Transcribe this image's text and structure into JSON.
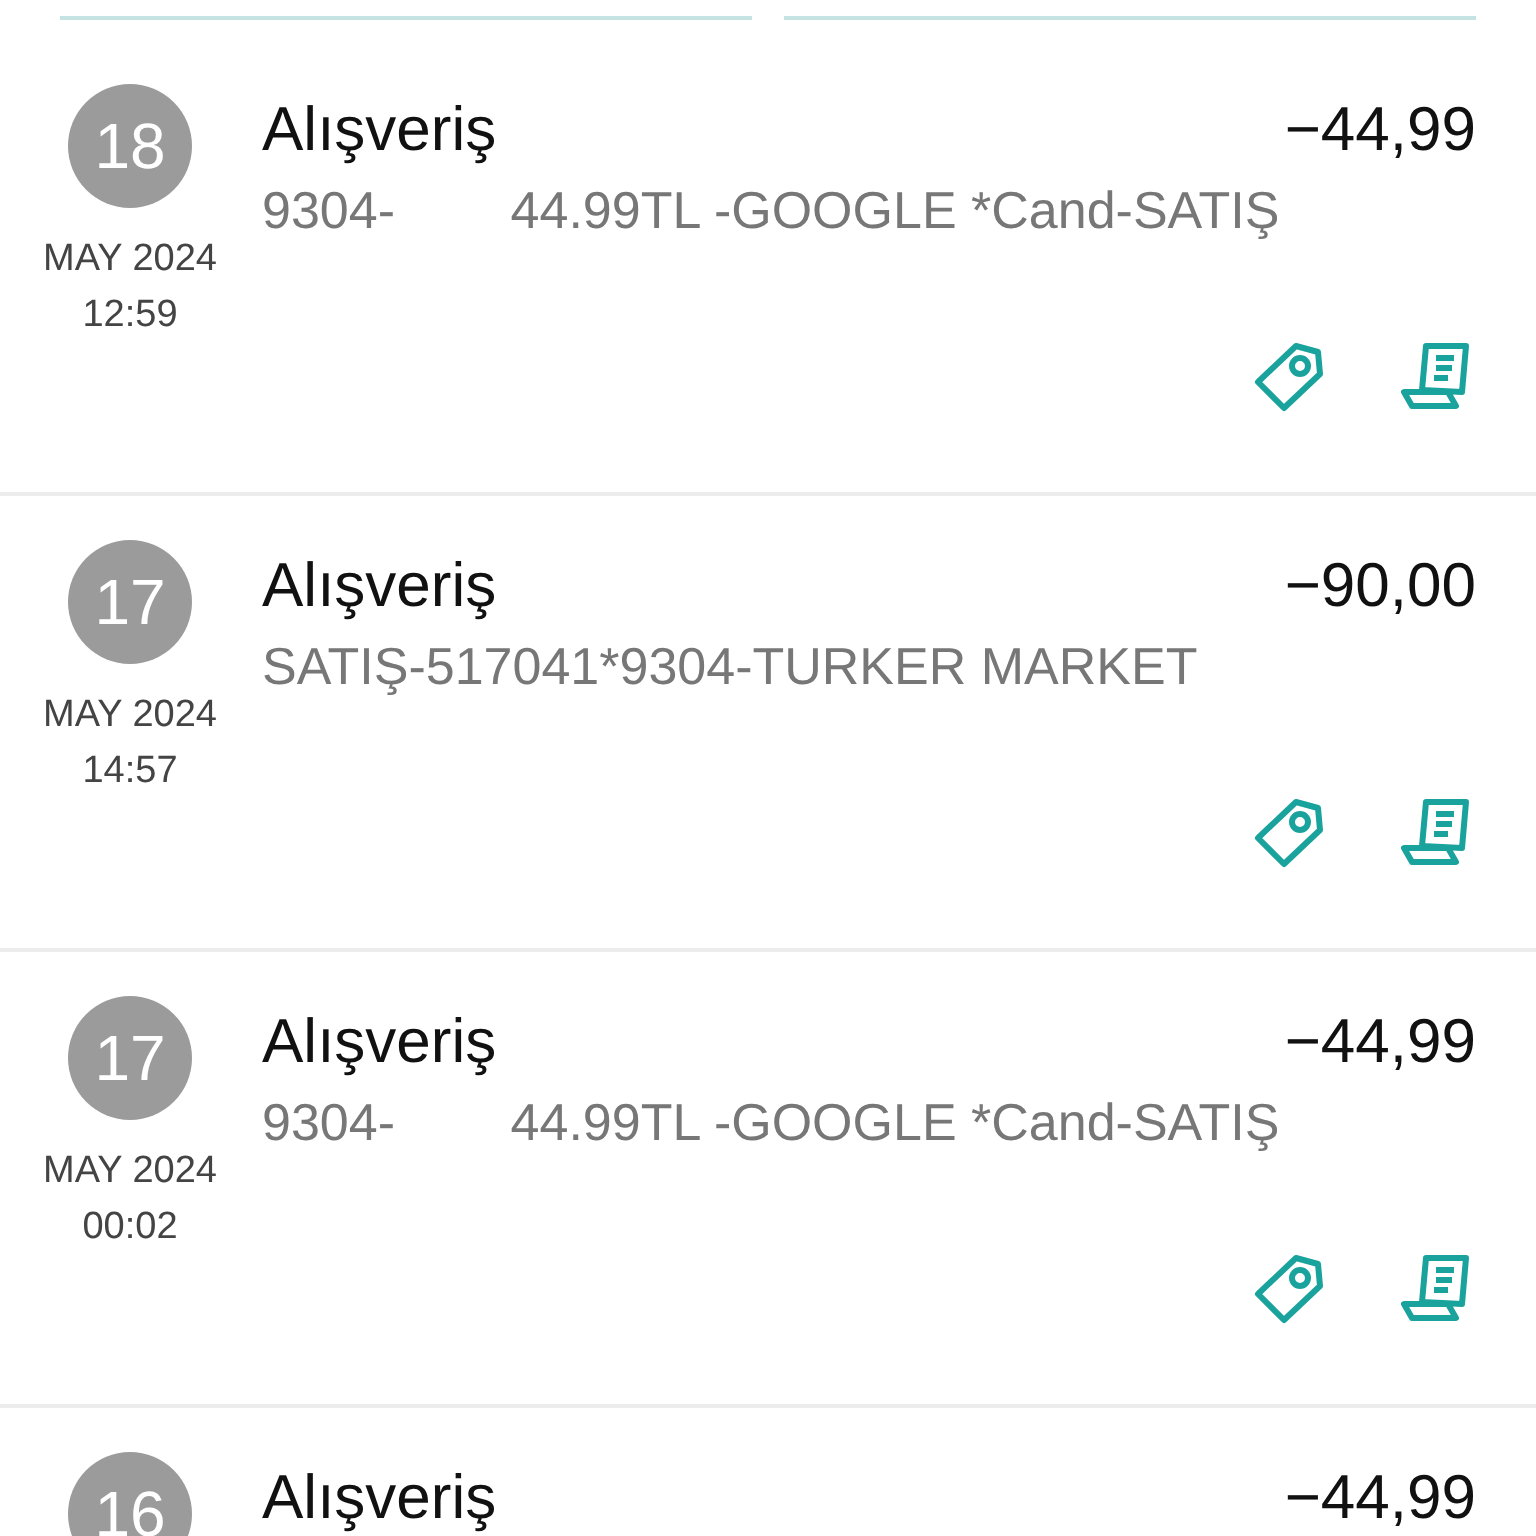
{
  "transactions": [
    {
      "day": "18",
      "month_year": "MAY 2024",
      "time": "12:59",
      "title": "Alışveriş",
      "description": "9304-        44.99TL -GOOGLE *Cand-SATIŞ",
      "amount": "−44,99"
    },
    {
      "day": "17",
      "month_year": "MAY 2024",
      "time": "14:57",
      "title": "Alışveriş",
      "description": "SATIŞ-517041*9304-TURKER MARKET",
      "amount": "−90,00"
    },
    {
      "day": "17",
      "month_year": "MAY 2024",
      "time": "00:02",
      "title": "Alışveriş",
      "description": "9304-        44.99TL -GOOGLE *Cand-SATIŞ",
      "amount": "−44,99"
    },
    {
      "day": "16",
      "title": "Alışveriş",
      "amount": "−44,99"
    }
  ]
}
